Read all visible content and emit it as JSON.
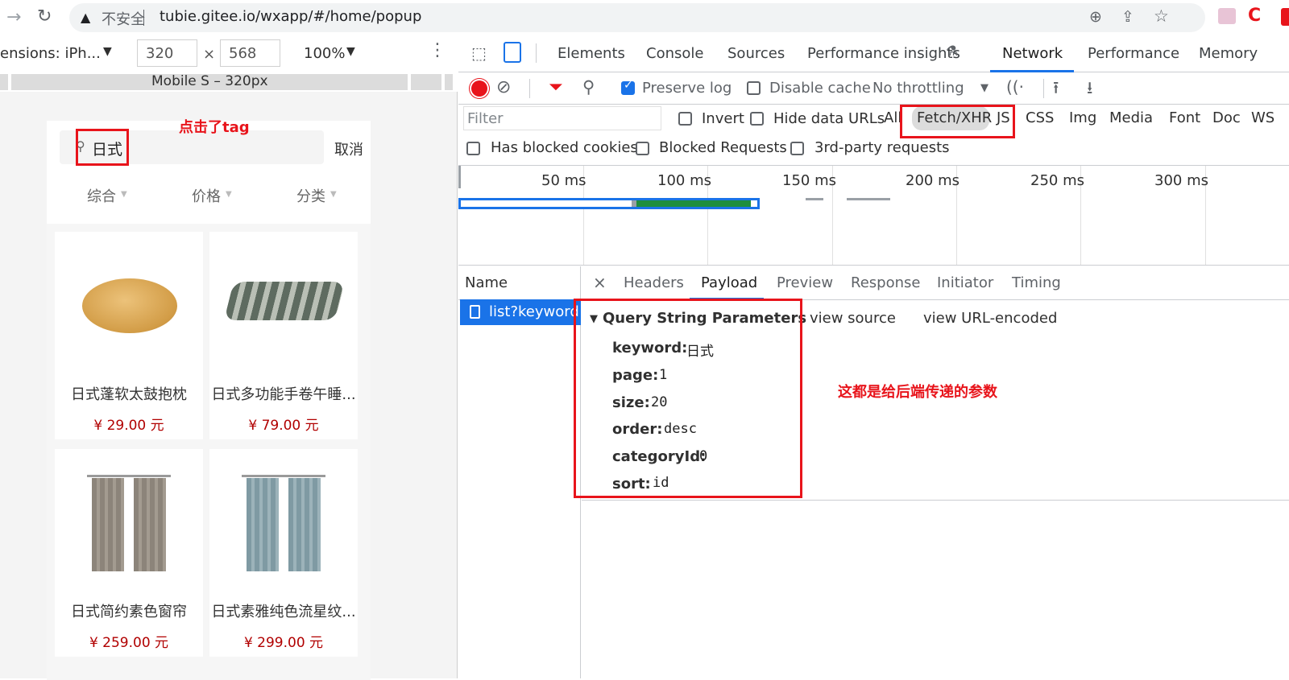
{
  "browser": {
    "security": "不安全",
    "url": "tubie.gitee.io/wxapp/#/home/popup"
  },
  "device_toolbar": {
    "dimensions_label": "ensions: iPh...",
    "width": "320",
    "height": "568",
    "times": "×",
    "zoom": "100%",
    "media_label": "Mobile S – 320px"
  },
  "app": {
    "search_value": "日式",
    "cancel_label": "取消",
    "annotation_tag": "点击了tag",
    "sort_tabs": [
      "综合",
      "价格",
      "分类"
    ],
    "products": [
      {
        "title": "日式蓬软太鼓抱枕",
        "price": "¥ 29.00 元"
      },
      {
        "title": "日式多功能手卷午睡...",
        "price": "¥ 79.00 元"
      },
      {
        "title": "日式简约素色窗帘",
        "price": "¥ 259.00 元"
      },
      {
        "title": "日式素雅纯色流星纹...",
        "price": "¥ 299.00 元"
      }
    ]
  },
  "devtools": {
    "tabs": [
      "Elements",
      "Console",
      "Sources",
      "Performance insights",
      "Network",
      "Performance",
      "Memory"
    ],
    "active_tab": "Network",
    "toolbar": {
      "preserve_log": "Preserve log",
      "disable_cache": "Disable cache",
      "throttling": "No throttling"
    },
    "filter": {
      "placeholder": "Filter",
      "invert": "Invert",
      "hide_data_urls": "Hide data URLs",
      "types": [
        "All",
        "Fetch/XHR",
        "JS",
        "CSS",
        "Img",
        "Media",
        "Font",
        "Doc",
        "WS"
      ],
      "has_blocked_cookies": "Has blocked cookies",
      "blocked_requests": "Blocked Requests",
      "third_party": "3rd-party requests"
    },
    "timeline_labels": [
      "50 ms",
      "100 ms",
      "150 ms",
      "200 ms",
      "250 ms",
      "300 ms"
    ],
    "name_header": "Name",
    "request_name": "list?keyword...",
    "detail_tabs": [
      "Headers",
      "Payload",
      "Preview",
      "Response",
      "Initiator",
      "Timing"
    ],
    "active_detail_tab": "Payload",
    "section_title": "Query String Parameters",
    "view_source": "view source",
    "view_url_encoded": "view URL-encoded",
    "params": [
      {
        "key": "keyword:",
        "value": "日式"
      },
      {
        "key": "page:",
        "value": "1"
      },
      {
        "key": "size:",
        "value": "20"
      },
      {
        "key": "order:",
        "value": "desc"
      },
      {
        "key": "categoryId:",
        "value": "0"
      },
      {
        "key": "sort:",
        "value": "id"
      }
    ],
    "annotation_params": "这都是给后端传递的参数"
  },
  "colors": {
    "annotation_red": "#e8141b",
    "devtools_blue": "#1a73e8",
    "price_red": "#b10000"
  }
}
